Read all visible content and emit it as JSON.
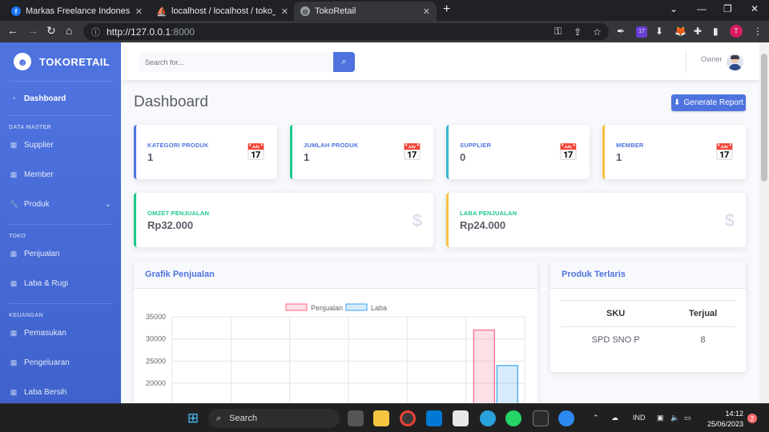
{
  "browser": {
    "tabs": [
      {
        "title": "Markas Freelance Indonesia | Fac",
        "favicon": "facebook-icon"
      },
      {
        "title": "localhost / localhost / toko_retail",
        "favicon": "phpmyadmin-icon"
      },
      {
        "title": "TokoRetail",
        "favicon": "globe-icon"
      }
    ],
    "url_host": "http://127.0.0.1",
    "url_port": ":8000",
    "profile_initial": "T",
    "ext_badge": "17"
  },
  "sidebar": {
    "brand": "TOKORETAIL",
    "dashboard": "Dashboard",
    "heading_master": "DATA MASTER",
    "supplier": "Supplier",
    "member": "Member",
    "produk": "Produk",
    "heading_toko": "TOKO",
    "penjualan": "Penjualan",
    "laba_rugi": "Laba & Rugi",
    "heading_keuangan": "KEUANGAN",
    "pemasukan": "Pemasukan",
    "pengeluaran": "Pengeluaran",
    "laba_bersih": "Laba Bersih"
  },
  "topbar": {
    "search_placeholder": "Search for...",
    "user_name": "Owner"
  },
  "page": {
    "title": "Dashboard",
    "report_button": "Generate Report"
  },
  "cards": [
    {
      "label": "KATEGORI PRODUK",
      "value": "1",
      "color": "#4e73df"
    },
    {
      "label": "JUMLAH PRODUK",
      "value": "1",
      "color": "#1cc88a"
    },
    {
      "label": "SUPPLIER",
      "value": "0",
      "color": "#36b9cc"
    },
    {
      "label": "MEMBER",
      "value": "1",
      "color": "#f6c23e"
    }
  ],
  "summary": [
    {
      "label": "OMZET PENJUALAN",
      "value": "Rp32.000",
      "color": "#1cc88a"
    },
    {
      "label": "LABA PENJUALAN",
      "value": "Rp24.000",
      "color": "#f6c23e"
    }
  ],
  "chart_panel": {
    "title": "Grafik Penjualan"
  },
  "best_panel": {
    "title": "Produk Terlaris",
    "headers": [
      "SKU",
      "Terjual"
    ],
    "rows": [
      [
        "SPD SNO P",
        "8"
      ]
    ]
  },
  "chart_data": {
    "type": "bar",
    "legend": [
      "Penjualan",
      "Laba"
    ],
    "legend_position": "top",
    "grid": true,
    "ylim": [
      0,
      35000
    ],
    "yticks": [
      "35000",
      "30000",
      "25000",
      "20000"
    ],
    "series": [
      {
        "name": "Penjualan",
        "values": [
          0,
          0,
          0,
          0,
          0,
          32000
        ],
        "color": "#ff6384"
      },
      {
        "name": "Laba",
        "values": [
          0,
          0,
          0,
          0,
          0,
          24000
        ],
        "color": "#36a2eb"
      }
    ]
  },
  "taskbar": {
    "search_label": "Search",
    "lang": "IND",
    "time": "14:12",
    "date": "25/06/2023",
    "notifications": "2"
  }
}
